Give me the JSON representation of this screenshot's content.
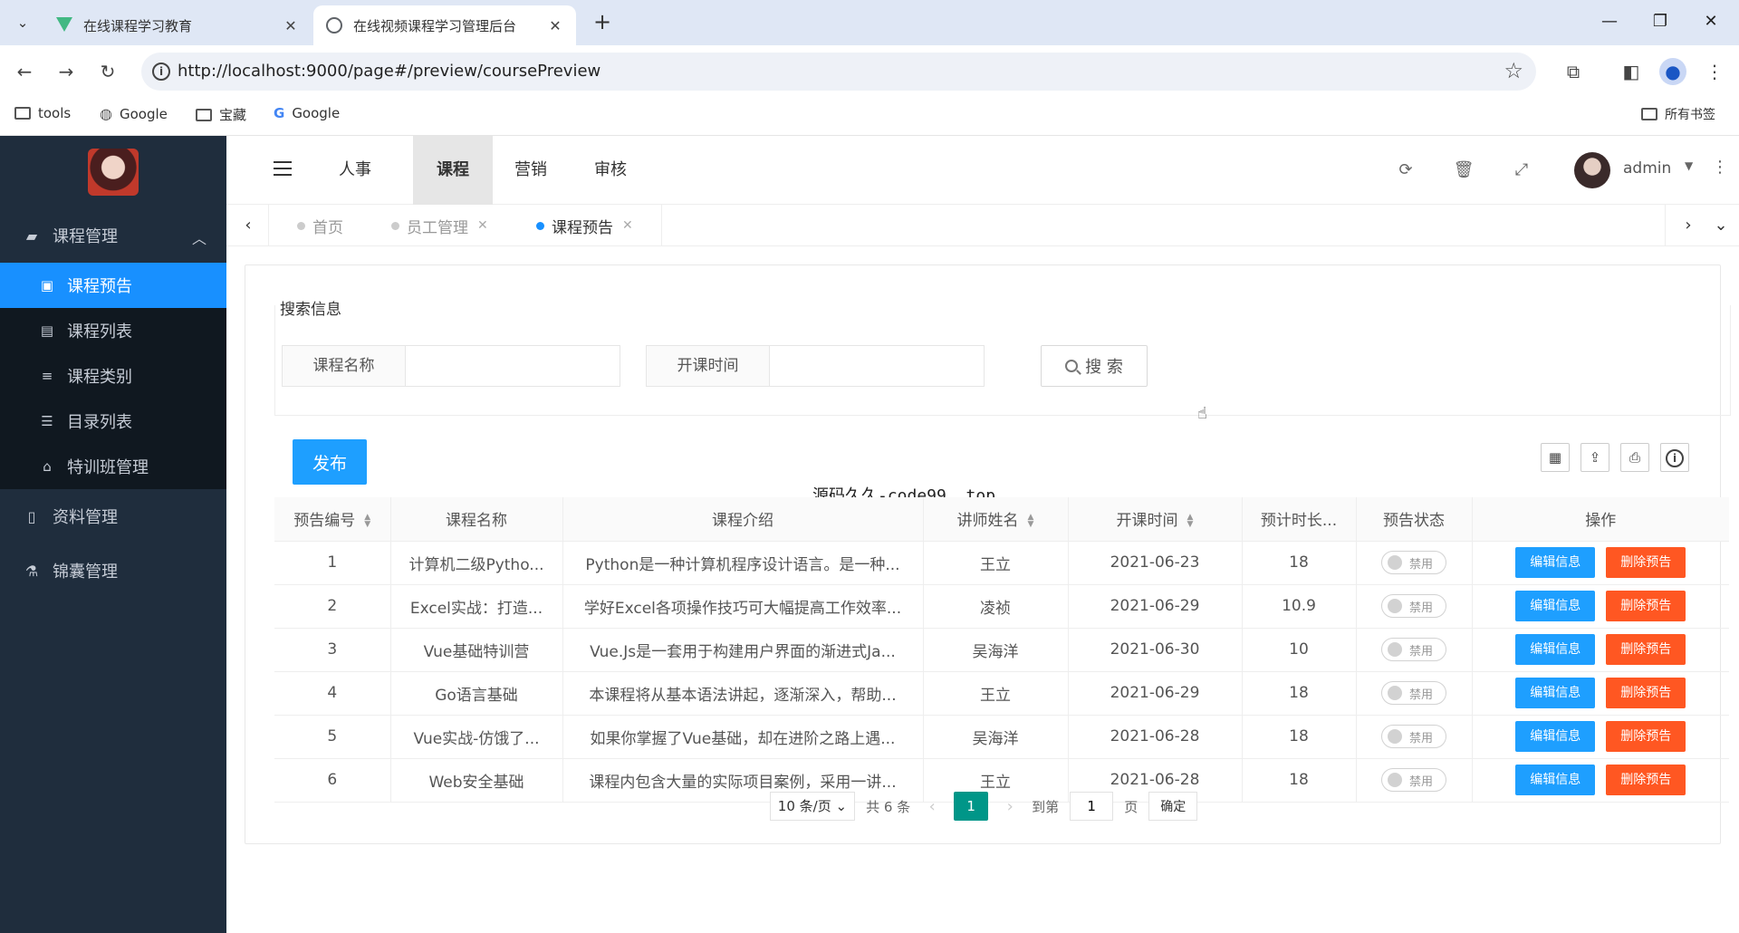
{
  "browser": {
    "tabs": [
      {
        "title": "在线课程学习教育",
        "active": false
      },
      {
        "title": "在线视频课程学习管理后台",
        "active": true
      }
    ],
    "url": "http://localhost:9000/page#/preview/coursePreview",
    "bookmarks": [
      "tools",
      "Google",
      "宝藏",
      "Google"
    ],
    "all_bookmarks": "所有书签"
  },
  "sidebar": {
    "groups": [
      {
        "label": "课程管理",
        "icon": "book-icon",
        "expanded": true,
        "items": [
          {
            "label": "课程预告",
            "icon": "monitor-icon",
            "active": true
          },
          {
            "label": "课程列表",
            "icon": "list-icon"
          },
          {
            "label": "课程类别",
            "icon": "menu-icon"
          },
          {
            "label": "目录列表",
            "icon": "sliders-icon"
          },
          {
            "label": "特训班管理",
            "icon": "bank-icon"
          }
        ]
      },
      {
        "label": "资料管理",
        "icon": "document-icon"
      },
      {
        "label": "锦囊管理",
        "icon": "flask-icon"
      }
    ]
  },
  "header": {
    "menus": [
      "人事",
      "课程",
      "营销",
      "审核"
    ],
    "active_menu": "课程",
    "user": "admin"
  },
  "tags": [
    {
      "label": "首页",
      "closable": false,
      "active": false
    },
    {
      "label": "员工管理",
      "closable": true,
      "active": false
    },
    {
      "label": "课程预告",
      "closable": true,
      "active": true
    }
  ],
  "search": {
    "title": "搜索信息",
    "course_name_label": "课程名称",
    "course_name_value": "",
    "start_time_label": "开课时间",
    "start_time_value": "",
    "button": "搜 索"
  },
  "toolbar": {
    "publish": "发布"
  },
  "watermark_text": "源码久久-code99. top",
  "table": {
    "columns": [
      "预告编号",
      "课程名称",
      "课程介绍",
      "讲师姓名",
      "开课时间",
      "预计时长...",
      "预告状态",
      "操作"
    ],
    "rows": [
      {
        "id": "1",
        "name": "计算机二级Pytho...",
        "intro": "Python是一种计算机程序设计语言。是一种...",
        "teacher": "王立",
        "date": "2021-06-23",
        "duration": "18",
        "status": "禁用"
      },
      {
        "id": "2",
        "name": "Excel实战：打造...",
        "intro": "学好Excel各项操作技巧可大幅提高工作效率...",
        "teacher": "凌祯",
        "date": "2021-06-29",
        "duration": "10.9",
        "status": "禁用"
      },
      {
        "id": "3",
        "name": "Vue基础特训营",
        "intro": "Vue.Js是一套用于构建用户界面的渐进式Ja...",
        "teacher": "吴海洋",
        "date": "2021-06-30",
        "duration": "10",
        "status": "禁用"
      },
      {
        "id": "4",
        "name": "Go语言基础",
        "intro": "本课程将从基本语法讲起，逐渐深入，帮助...",
        "teacher": "王立",
        "date": "2021-06-29",
        "duration": "18",
        "status": "禁用"
      },
      {
        "id": "5",
        "name": "Vue实战-仿饿了...",
        "intro": "如果你掌握了Vue基础，却在进阶之路上遇...",
        "teacher": "吴海洋",
        "date": "2021-06-28",
        "duration": "18",
        "status": "禁用"
      },
      {
        "id": "6",
        "name": "Web安全基础",
        "intro": "课程内包含大量的实际项目案例，采用一讲...",
        "teacher": "王立",
        "date": "2021-06-28",
        "duration": "18",
        "status": "禁用"
      }
    ],
    "edit_label": "编辑信息",
    "delete_label": "删除预告"
  },
  "pagination": {
    "page_size": "10 条/页",
    "total": "共 6 条",
    "current": "1",
    "goto_label": "到第",
    "goto_value": "1",
    "page_unit": "页",
    "confirm": "确定"
  }
}
